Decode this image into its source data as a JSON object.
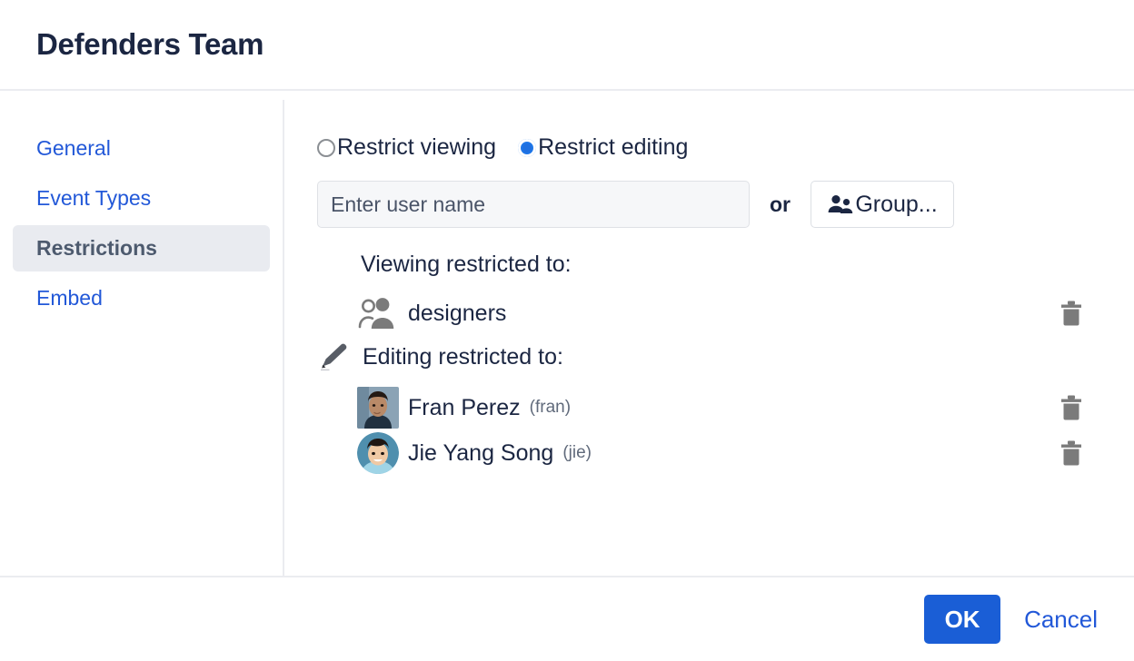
{
  "dialog": {
    "title": "Defenders Team"
  },
  "sidebar": {
    "items": [
      {
        "label": "General",
        "active": false
      },
      {
        "label": "Event Types",
        "active": false
      },
      {
        "label": "Restrictions",
        "active": true
      },
      {
        "label": "Embed",
        "active": false
      }
    ]
  },
  "restrictions": {
    "radios": [
      {
        "label": "Restrict viewing",
        "selected": false
      },
      {
        "label": "Restrict editing",
        "selected": true
      }
    ],
    "user_input": {
      "placeholder": "Enter user name",
      "value": ""
    },
    "or_label": "or",
    "group_button": {
      "label": "Group...",
      "icon": "users-icon"
    },
    "viewing_section": {
      "title": "Viewing restricted to:",
      "icon": "",
      "entries": [
        {
          "name": "designers",
          "key": "",
          "avatar": "group-icon",
          "delete_icon": "trash-icon"
        }
      ]
    },
    "editing_section": {
      "title": "Editing restricted to:",
      "icon": "pencil-icon",
      "entries": [
        {
          "name": "Fran Perez",
          "key": "(fran)",
          "avatar": "photo-square",
          "delete_icon": "trash-icon"
        },
        {
          "name": "Jie Yang Song",
          "key": "(jie)",
          "avatar": "photo-round",
          "delete_icon": "trash-icon"
        }
      ]
    }
  },
  "footer": {
    "ok_label": "OK",
    "cancel_label": "Cancel"
  },
  "colors": {
    "accent": "#1a5ed6",
    "link": "#2258d8",
    "title": "#1b2642",
    "active_bg": "#e9ebf0",
    "divider": "#ebecf0"
  }
}
